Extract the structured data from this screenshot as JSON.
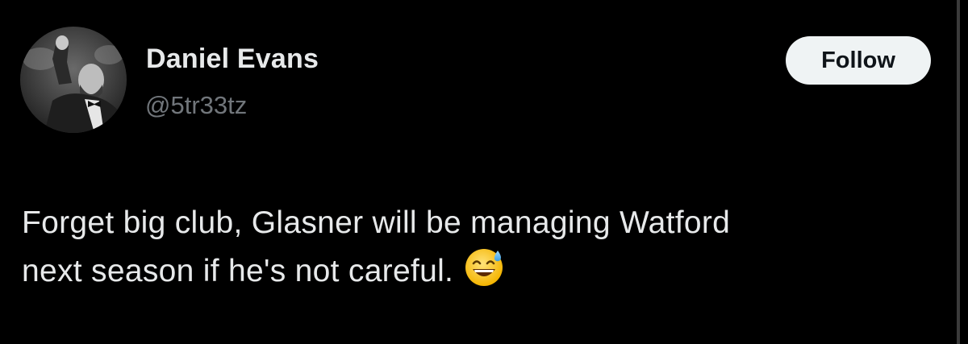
{
  "author": {
    "name": "Daniel Evans",
    "handle": "@5tr33tz"
  },
  "follow_button": {
    "label": "Follow"
  },
  "tweet": {
    "line1": "Forget big club, Glasner will be managing Watford",
    "line2": "next season if he's not careful.",
    "emoji": "grinning-face-with-sweat-icon"
  },
  "colors": {
    "background": "#000000",
    "text": "#e7e9ea",
    "handle": "#71767b",
    "button_bg": "#eff3f4",
    "button_text": "#0f1419"
  }
}
